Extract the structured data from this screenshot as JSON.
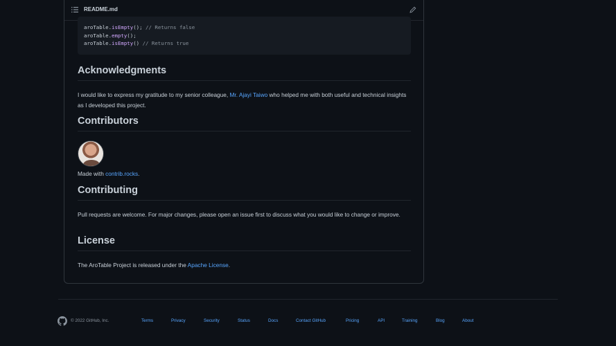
{
  "readme": {
    "filename": "README.md",
    "code_lines": [
      {
        "obj": "aroTable.",
        "fn": "isEmpty",
        "rest": "(); ",
        "comment": "// Returns false"
      },
      {
        "obj": "aroTable.",
        "fn": "empty",
        "rest": "();",
        "comment": ""
      },
      {
        "obj": "aroTable.",
        "fn": "isEmpty",
        "rest": "() ",
        "comment": "// Returns true"
      }
    ],
    "acknowledgments": {
      "heading": "Acknowledgments",
      "text_before": "I would like to express my gratitude to my senior colleague, ",
      "link": "Mr. Ajayi Taiwo",
      "text_after": " who helped me with both useful and technical insights as I developed this project."
    },
    "contributors": {
      "heading": "Contributors",
      "made_with": "Made with ",
      "link": "contrib.rocks",
      "period": "."
    },
    "contributing": {
      "heading": "Contributing",
      "text": "Pull requests are welcome. For major changes, please open an issue first to discuss what you would like to change or improve."
    },
    "license": {
      "heading": "License",
      "text_before": "The AroTable Project is released under the ",
      "link": "Apache License",
      "text_after": "."
    }
  },
  "footer": {
    "copyright": "© 2022 GitHub, Inc.",
    "links": [
      "Terms",
      "Privacy",
      "Security",
      "Status",
      "Docs",
      "Contact GitHub",
      "Pricing",
      "API",
      "Training",
      "Blog",
      "About"
    ]
  },
  "colors": {
    "background": "#0d1117",
    "link": "#58a6ff",
    "text": "#c9d1d9",
    "muted": "#8b949e",
    "code_function": "#d2a8ff"
  },
  "icons": [
    "list-icon",
    "pencil-icon",
    "github-logo-icon"
  ]
}
